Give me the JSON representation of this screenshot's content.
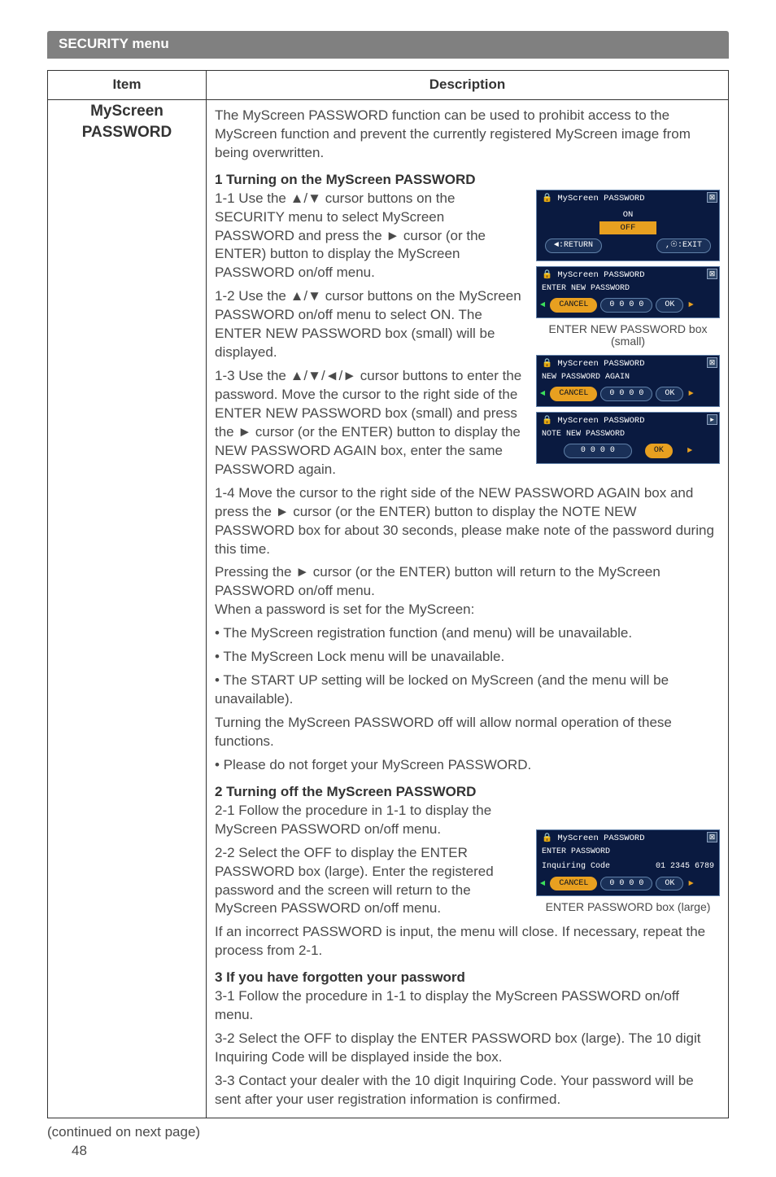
{
  "banner": "SECURITY menu",
  "headers": {
    "item": "Item",
    "desc": "Description"
  },
  "item_name_l1": "MyScreen",
  "item_name_l2": "PASSWORD",
  "intro": "The MyScreen PASSWORD function can be used to prohibit access to the MyScreen function and prevent the currently registered MyScreen image from being overwritten.",
  "s1": {
    "heading": "1 Turning on the MyScreen PASSWORD",
    "step1": "1-1 Use the ▲/▼ cursor buttons on the SECURITY menu to select MyScreen PASSWORD and press the ► cursor (or the ENTER) button to display the MyScreen PASSWORD on/off menu.",
    "step2": "1-2 Use the ▲/▼ cursor buttons on the MyScreen PASSWORD on/off menu to select ON. The ENTER NEW PASSWORD box (small) will be displayed.",
    "step3": "1-3 Use the ▲/▼/◄/► cursor buttons to enter the password. Move the cursor to the right side of the ENTER NEW PASSWORD box (small) and press the ► cursor (or the ENTER) button to display the NEW PASSWORD AGAIN box, enter the same PASSWORD again.",
    "step4": "1-4 Move the cursor to the right side of the NEW PASSWORD AGAIN box and press the ► cursor (or the ENTER) button to display the NOTE NEW PASSWORD box for about 30 seconds, please make note of the password during this time.",
    "step4b": "Pressing the ► cursor (or the ENTER) button will return to the MyScreen PASSWORD on/off menu.",
    "notes_intro": "When a password is set for the MyScreen:",
    "note1": "• The MyScreen registration function (and menu) will be unavailable.",
    "note2": "• The MyScreen Lock menu will be unavailable.",
    "note3": "• The START UP setting will be locked on MyScreen (and the menu will be unavailable).",
    "note4": "Turning the MyScreen PASSWORD off will allow normal operation of these functions.",
    "note5": "• Please do not forget your MyScreen PASSWORD."
  },
  "s2": {
    "heading": "2 Turning off the MyScreen PASSWORD",
    "step1": "2-1 Follow the procedure in 1-1 to display the MyScreen PASSWORD on/off menu.",
    "step2": "2-2 Select the OFF to display the ENTER PASSWORD box (large). Enter the registered password and the screen will return to the MyScreen PASSWORD on/off menu.",
    "tail": "If an incorrect PASSWORD is input, the menu will close. If necessary, repeat the process from 2-1."
  },
  "s3": {
    "heading": "3 If you have forgotten your password",
    "step1": "3-1 Follow the procedure in 1-1 to display the MyScreen PASSWORD on/off menu.",
    "step2": "3-2 Select the OFF to display the ENTER PASSWORD box (large). The 10 digit Inquiring Code will be displayed inside the box.",
    "step3": "3-3 Contact your dealer with the 10 digit Inquiring Code. Your password will be sent after your user registration information is confirmed."
  },
  "dialogs": {
    "d1": {
      "title": "MyScreen PASSWORD",
      "on": "ON",
      "off": "OFF",
      "ret": "◄:RETURN",
      "exit": ",☉:EXIT"
    },
    "d2": {
      "title": "MyScreen PASSWORD",
      "label": "ENTER NEW PASSWORD",
      "cancel": "CANCEL",
      "digits": "0 0 0 0",
      "ok": "OK"
    },
    "d2cap": "ENTER NEW PASSWORD box (small)",
    "d3": {
      "title": "MyScreen PASSWORD",
      "label": "NEW PASSWORD AGAIN",
      "cancel": "CANCEL",
      "digits": "0 0 0 0",
      "ok": "OK"
    },
    "d4": {
      "title": "MyScreen PASSWORD",
      "label": "NOTE NEW PASSWORD",
      "digits": "0 0 0 0",
      "ok": "OK"
    },
    "d5": {
      "title": "MyScreen PASSWORD",
      "label": "ENTER PASSWORD",
      "inq": "Inquiring Code",
      "code": "01 2345 6789",
      "cancel": "CANCEL",
      "digits": "0 0 0 0",
      "ok": "OK"
    },
    "d5cap": "ENTER PASSWORD box (large)"
  },
  "continued": "(continued on next page)",
  "page": "48"
}
